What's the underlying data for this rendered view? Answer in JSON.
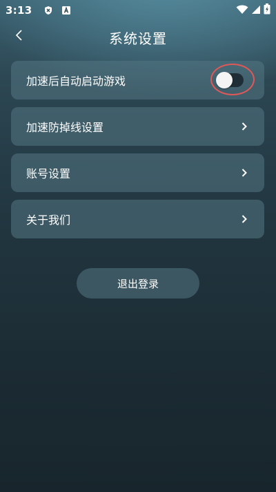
{
  "status_bar": {
    "time": "3:13",
    "left_icons": [
      "shield-x-icon",
      "keyboard-a-icon"
    ],
    "right_icons": [
      "wifi-icon",
      "signal-icon",
      "battery-charging-icon"
    ]
  },
  "header": {
    "back_icon": "chevron-left-icon",
    "title": "系统设置"
  },
  "settings": {
    "items": [
      {
        "label": "加速后自动启动游戏",
        "control": "toggle",
        "toggle_on": false
      },
      {
        "label": "加速防掉线设置",
        "control": "chevron"
      },
      {
        "label": "账号设置",
        "control": "chevron"
      },
      {
        "label": "关于我们",
        "control": "chevron"
      }
    ]
  },
  "logout": {
    "label": "退出登录"
  },
  "colors": {
    "card_bg": "#54768499",
    "highlight_ring": "#e05858",
    "text": "#ffffff"
  }
}
